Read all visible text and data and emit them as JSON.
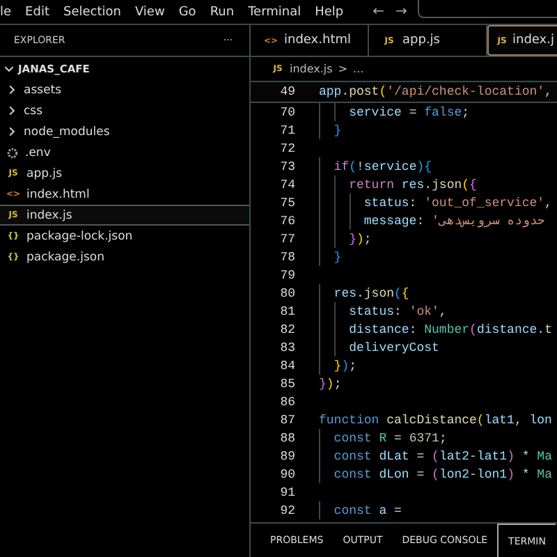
{
  "menu_bar": {
    "items": [
      "le",
      "Edit",
      "Selection",
      "View",
      "Go",
      "Run",
      "Terminal",
      "Help"
    ],
    "back": "←",
    "forward": "→"
  },
  "sidebar": {
    "title": "EXPLORER",
    "more": "···",
    "root": {
      "label": "JANAS_CAFE",
      "expanded": true,
      "children": [
        {
          "label": "assets",
          "kind": "folder",
          "expanded": false,
          "selected": false
        },
        {
          "label": "css",
          "kind": "folder",
          "expanded": false,
          "selected": false
        },
        {
          "label": "node_modules",
          "kind": "folder",
          "expanded": false,
          "selected": false
        },
        {
          "label": ".env",
          "kind": "env",
          "selected": false
        },
        {
          "label": "app.js",
          "kind": "js",
          "icon": "JS",
          "selected": false
        },
        {
          "label": "index.html",
          "kind": "html",
          "icon": "<>",
          "selected": false
        },
        {
          "label": "index.js",
          "kind": "js",
          "icon": "JS",
          "selected": true
        },
        {
          "label": "package-lock.json",
          "kind": "json",
          "icon": "{}",
          "selected": false
        },
        {
          "label": "package.json",
          "kind": "json",
          "icon": "{}",
          "selected": false
        }
      ]
    }
  },
  "tabs": [
    {
      "label": "index.html",
      "kind": "html",
      "icon": "<>",
      "selected": false
    },
    {
      "label": "app.js",
      "kind": "js",
      "icon": "JS",
      "selected": false
    },
    {
      "label": "index.j",
      "kind": "js",
      "icon": "JS",
      "selected": true
    }
  ],
  "breadcrumb": {
    "file": "index.js",
    "kind": "js",
    "icon": "JS",
    "separator": ">",
    "rest": "..."
  },
  "editor": {
    "sticky": {
      "number": "49",
      "tokens": [
        {
          "kind": "var",
          "t": "app"
        },
        {
          "kind": "p",
          "t": "."
        },
        {
          "kind": "fn",
          "t": "post"
        },
        {
          "kind": "b1",
          "t": "("
        },
        {
          "kind": "str",
          "t": "'/api/check-location'"
        },
        {
          "kind": "p",
          "t": ","
        }
      ]
    },
    "lines": [
      {
        "number": "70",
        "tokens": [
          {
            "kind": "var",
            "t": "    service "
          },
          {
            "kind": "p",
            "t": "= "
          },
          {
            "kind": "kw",
            "t": "false"
          },
          {
            "kind": "p",
            "t": ";"
          }
        ]
      },
      {
        "number": "71",
        "tokens": [
          {
            "kind": "b3",
            "t": "  }"
          }
        ]
      },
      {
        "number": "72"
      },
      {
        "number": "73",
        "tokens": [
          {
            "kind": "ctl",
            "t": "  if"
          },
          {
            "kind": "b3",
            "t": "("
          },
          {
            "kind": "p",
            "t": "!"
          },
          {
            "kind": "var",
            "t": "service"
          },
          {
            "kind": "b3",
            "t": "){"
          }
        ]
      },
      {
        "number": "74",
        "tokens": [
          {
            "kind": "ctl",
            "t": "    return "
          },
          {
            "kind": "var",
            "t": "res"
          },
          {
            "kind": "p",
            "t": "."
          },
          {
            "kind": "fn",
            "t": "json"
          },
          {
            "kind": "b1",
            "t": "("
          },
          {
            "kind": "b2",
            "t": "{"
          }
        ]
      },
      {
        "number": "75",
        "tokens": [
          {
            "kind": "var",
            "t": "      status"
          },
          {
            "kind": "p",
            "t": ": "
          },
          {
            "kind": "str",
            "t": "'out_of_service'"
          },
          {
            "kind": "p",
            "t": ","
          }
        ]
      },
      {
        "number": "76",
        "tokens": [
          {
            "kind": "var",
            "t": "      message"
          },
          {
            "kind": "p",
            "t": ": "
          },
          {
            "kind": "str",
            "t": "'"
          },
          {
            "kind": "rtl",
            "t": "حدوده سرویس‌دهی"
          }
        ]
      },
      {
        "number": "77",
        "tokens": [
          {
            "kind": "b2",
            "t": "    }"
          },
          {
            "kind": "b1",
            "t": ")"
          },
          {
            "kind": "p",
            "t": ";"
          }
        ]
      },
      {
        "number": "78",
        "tokens": [
          {
            "kind": "b3",
            "t": "  }"
          }
        ]
      },
      {
        "number": "79"
      },
      {
        "number": "80",
        "tokens": [
          {
            "kind": "var",
            "t": "  res"
          },
          {
            "kind": "p",
            "t": "."
          },
          {
            "kind": "fn",
            "t": "json"
          },
          {
            "kind": "b3",
            "t": "("
          },
          {
            "kind": "b1",
            "t": "{"
          }
        ]
      },
      {
        "number": "81",
        "tokens": [
          {
            "kind": "var",
            "t": "    status"
          },
          {
            "kind": "p",
            "t": ": "
          },
          {
            "kind": "str",
            "t": "'ok'"
          },
          {
            "kind": "p",
            "t": ","
          }
        ]
      },
      {
        "number": "82",
        "tokens": [
          {
            "kind": "var",
            "t": "    distance"
          },
          {
            "kind": "p",
            "t": ": "
          },
          {
            "kind": "cls",
            "t": "Number"
          },
          {
            "kind": "b2",
            "t": "("
          },
          {
            "kind": "var",
            "t": "distance"
          },
          {
            "kind": "p",
            "t": "."
          },
          {
            "kind": "fn",
            "t": "t"
          }
        ]
      },
      {
        "number": "83",
        "tokens": [
          {
            "kind": "var",
            "t": "    deliveryCost"
          }
        ]
      },
      {
        "number": "84",
        "tokens": [
          {
            "kind": "b1",
            "t": "  }"
          },
          {
            "kind": "b3",
            "t": ")"
          },
          {
            "kind": "p",
            "t": ";"
          }
        ]
      },
      {
        "number": "85",
        "tokens": [
          {
            "kind": "b2",
            "t": "}"
          },
          {
            "kind": "b1",
            "t": ")"
          },
          {
            "kind": "p",
            "t": ";"
          }
        ]
      },
      {
        "number": "86"
      },
      {
        "number": "87",
        "tokens": [
          {
            "kind": "kw",
            "t": "function "
          },
          {
            "kind": "fn",
            "t": "calcDistance"
          },
          {
            "kind": "b1",
            "t": "("
          },
          {
            "kind": "var",
            "t": "lat1"
          },
          {
            "kind": "p",
            "t": ", "
          },
          {
            "kind": "var",
            "t": "lon"
          }
        ]
      },
      {
        "number": "88",
        "tokens": [
          {
            "kind": "kw",
            "t": "  const "
          },
          {
            "kind": "cls",
            "t": "R "
          },
          {
            "kind": "p",
            "t": "= "
          },
          {
            "kind": "num",
            "t": "6371"
          },
          {
            "kind": "p",
            "t": ";"
          }
        ]
      },
      {
        "number": "89",
        "tokens": [
          {
            "kind": "kw",
            "t": "  const "
          },
          {
            "kind": "var",
            "t": "dLat "
          },
          {
            "kind": "p",
            "t": "= "
          },
          {
            "kind": "b2",
            "t": "("
          },
          {
            "kind": "var",
            "t": "lat2"
          },
          {
            "kind": "p",
            "t": "-"
          },
          {
            "kind": "var",
            "t": "lat1"
          },
          {
            "kind": "b2",
            "t": ")"
          },
          {
            "kind": "p",
            "t": " * "
          },
          {
            "kind": "cls",
            "t": "Ma"
          }
        ]
      },
      {
        "number": "90",
        "tokens": [
          {
            "kind": "kw",
            "t": "  const "
          },
          {
            "kind": "var",
            "t": "dLon "
          },
          {
            "kind": "p",
            "t": "= "
          },
          {
            "kind": "b2",
            "t": "("
          },
          {
            "kind": "var",
            "t": "lon2"
          },
          {
            "kind": "p",
            "t": "-"
          },
          {
            "kind": "var",
            "t": "lon1"
          },
          {
            "kind": "b2",
            "t": ")"
          },
          {
            "kind": "p",
            "t": " * "
          },
          {
            "kind": "cls",
            "t": "Ma"
          }
        ]
      },
      {
        "number": "91"
      },
      {
        "number": "92",
        "tokens": [
          {
            "kind": "kw",
            "t": "  const "
          },
          {
            "kind": "var",
            "t": "a "
          },
          {
            "kind": "p",
            "t": "="
          }
        ]
      }
    ]
  },
  "panel": {
    "tabs": [
      {
        "label": "PROBLEMS",
        "selected": false
      },
      {
        "label": "OUTPUT",
        "selected": false
      },
      {
        "label": "DEBUG CONSOLE",
        "selected": false
      },
      {
        "label": "TERMIN",
        "selected": true
      }
    ]
  }
}
